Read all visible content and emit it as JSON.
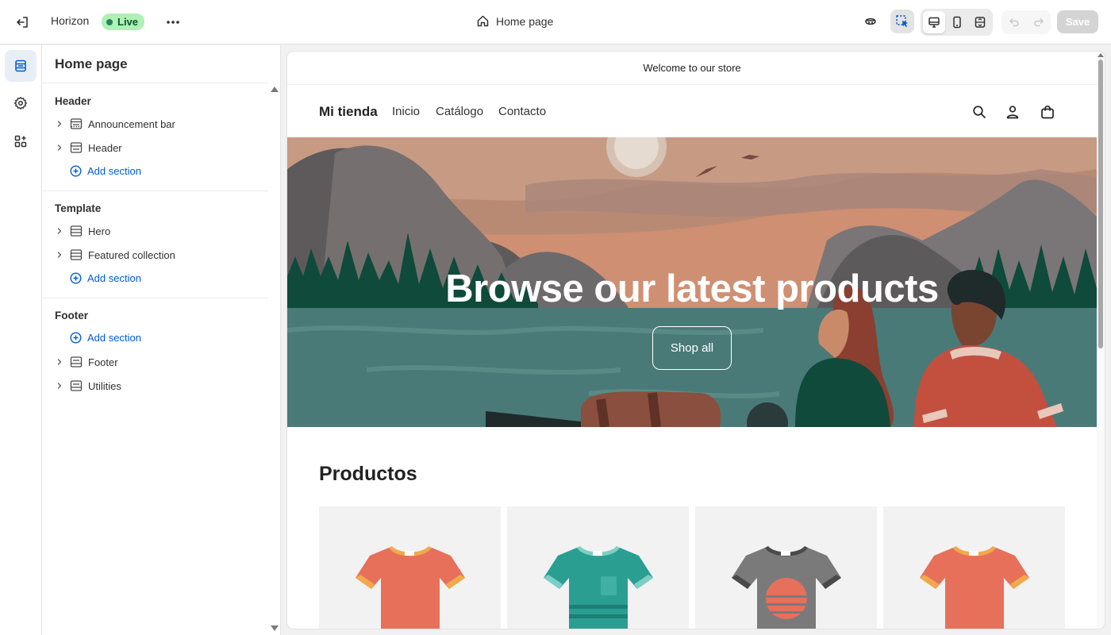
{
  "topbar": {
    "theme_name": "Horizon",
    "status_badge": "Live",
    "page_selector": "Home page",
    "save_label": "Save"
  },
  "rail": {
    "items": [
      {
        "icon": "sections-icon"
      },
      {
        "icon": "gear-icon"
      },
      {
        "icon": "apps-icon"
      }
    ]
  },
  "sidebar": {
    "title": "Home page",
    "groups": [
      {
        "title": "Header",
        "items": [
          {
            "label": "Announcement bar"
          },
          {
            "label": "Header"
          }
        ],
        "add_label": "Add section"
      },
      {
        "title": "Template",
        "items": [
          {
            "label": "Hero"
          },
          {
            "label": "Featured collection"
          }
        ],
        "add_label": "Add section"
      },
      {
        "title": "Footer",
        "add_label": "Add section",
        "items": [
          {
            "label": "Footer"
          },
          {
            "label": "Utilities"
          }
        ]
      }
    ]
  },
  "preview": {
    "announcement": "Welcome to our store",
    "store_name": "Mi tienda",
    "nav": [
      "Inicio",
      "Catálogo",
      "Contacto"
    ],
    "hero_title": "Browse our latest products",
    "hero_button": "Shop all",
    "products_title": "Productos",
    "products": [
      {
        "color": "#e7705b",
        "trim": "#f2a94a"
      },
      {
        "color": "#2b9e92",
        "trim": "#7ccfc5"
      },
      {
        "color": "#7a7a7a",
        "trim": "#4a4a4a"
      },
      {
        "color": "#e7705b",
        "trim": "#f2a94a"
      }
    ]
  },
  "colors": {
    "accent": "#005bd3",
    "live_badge_bg": "#aff0b5",
    "live_badge_text": "#0c5132"
  }
}
